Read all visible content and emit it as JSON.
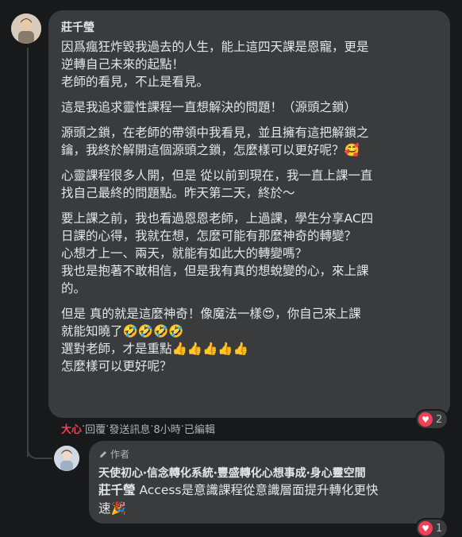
{
  "comment": {
    "author": "莊千瑩",
    "lines": [
      "因爲瘋狂炸毀我過去的人生，能上這四天課是恩寵，更是",
      "逆轉自己未來的起點！",
      "老師的看見，不止是看見。",
      "",
      "這是我追求靈性課程一直想解決的問題！（源頭之鎖）",
      "",
      "源頭之鎖，在老師的帶領中我看見，並且擁有這把解鎖之",
      "鑰，我終於解開這個源頭之鎖，怎麼樣可以更好呢？🥰",
      "",
      "心靈課程很多人開，但是 從以前到現在，我一直上課一直",
      "找自己最終的問題點。昨天第二天，終於～",
      "",
      "要上課之前，我也看過恩恩老師，上過課，學生分享AC四",
      "日課的心得，我就在想，怎麼可能有那麼神奇的轉變？",
      "心想才上一、兩天，就能有如此大的轉變嗎？",
      "我也是抱著不敢相信，但是我有真的想蛻變的心，來上課",
      "的。",
      "",
      "但是 真的就是這麼神奇！像魔法一樣😍，你自己來上課",
      "就能知曉了🤣🤣🤣🤣",
      "選對老師，才是重點👍👍👍👍👍",
      "怎麼樣可以更好呢？"
    ],
    "reaction_count": "2",
    "actions": {
      "love": "大心",
      "reply": "回覆",
      "message": "發送訊息",
      "time": "8小時",
      "edited": "已編輯",
      "sep": " · "
    }
  },
  "reply": {
    "author_tag": "作者",
    "author": "天使初心‧信念轉化系統‧豐盛轉化心想事成‧身心靈空間",
    "mention": "莊千瑩",
    "line1_rest": " Access是意識課程從意識層面提升轉化更快",
    "line2": "速🎉",
    "reaction_count": "1"
  },
  "colors": {
    "background": "#18191a",
    "bubble": "#3a3b3c",
    "text": "#e4e6eb",
    "secondary": "#b0b3b8",
    "love": "#f33e58"
  }
}
